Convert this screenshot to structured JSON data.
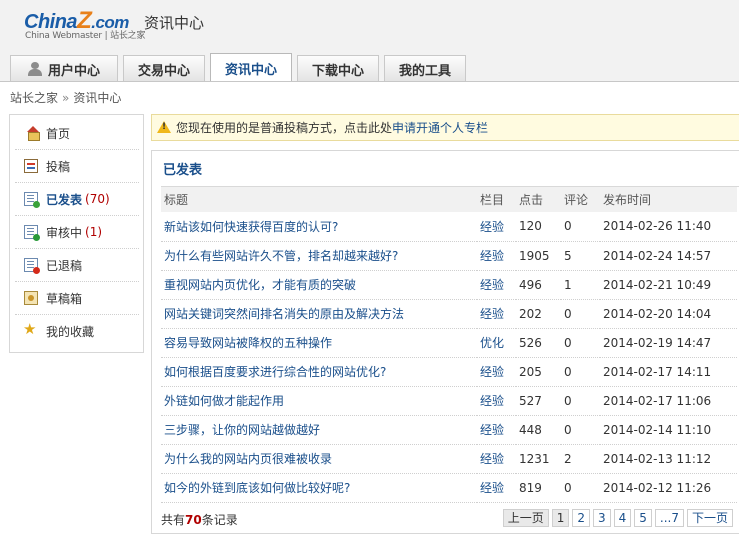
{
  "brand": {
    "logo_main_a": "China",
    "logo_main_z": "Z",
    "logo_main_c": ".com",
    "logo_sub": "China Webmaster | 站长之家",
    "site_title": "资讯中心"
  },
  "tabs": [
    {
      "label": "用户中心",
      "icon": "user-icon",
      "active": false
    },
    {
      "label": "交易中心",
      "active": false
    },
    {
      "label": "资讯中心",
      "active": true
    },
    {
      "label": "下载中心",
      "active": false
    },
    {
      "label": "我的工具",
      "active": false
    }
  ],
  "breadcrumb": {
    "home": "站长之家",
    "separator": "»",
    "current": "资讯中心"
  },
  "sidebar": {
    "items": [
      {
        "label": "首页",
        "icon": "home-icon"
      },
      {
        "label": "投稿",
        "icon": "submit-icon"
      },
      {
        "label": "已发表",
        "count": "(70)",
        "icon": "published-doc-icon",
        "active": true
      },
      {
        "label": "审核中",
        "count": "(1)",
        "icon": "pending-doc-icon"
      },
      {
        "label": "已退稿",
        "icon": "rejected-doc-icon"
      },
      {
        "label": "草稿箱",
        "icon": "drafts-icon"
      },
      {
        "label": "我的收藏",
        "icon": "favorites-star-icon"
      }
    ]
  },
  "notice": {
    "icon": "warning-icon",
    "text": "您现在使用的是普通投稿方式，点击此处",
    "link": "申请开通个人专栏"
  },
  "panel": {
    "title": "已发表",
    "columns": [
      "标题",
      "栏目",
      "点击",
      "评论",
      "发布时间"
    ],
    "rows": [
      {
        "title": "新站该如何快速获得百度的认可?",
        "category": "经验",
        "clicks": "120",
        "comments": "0",
        "time": "2014-02-26 11:40"
      },
      {
        "title": "为什么有些网站许久不管，排名却越来越好?",
        "category": "经验",
        "clicks": "1905",
        "comments": "5",
        "time": "2014-02-24 14:57"
      },
      {
        "title": "重视网站内页优化，才能有质的突破",
        "category": "经验",
        "clicks": "496",
        "comments": "1",
        "time": "2014-02-21 10:49"
      },
      {
        "title": "网站关键词突然间排名消失的原由及解决方法",
        "category": "经验",
        "clicks": "202",
        "comments": "0",
        "time": "2014-02-20 14:04"
      },
      {
        "title": "容易导致网站被降权的五种操作",
        "category": "优化",
        "clicks": "526",
        "comments": "0",
        "time": "2014-02-19 14:47"
      },
      {
        "title": "如何根据百度要求进行综合性的网站优化?",
        "category": "经验",
        "clicks": "205",
        "comments": "0",
        "time": "2014-02-17 14:11"
      },
      {
        "title": "外链如何做才能起作用",
        "category": "经验",
        "clicks": "527",
        "comments": "0",
        "time": "2014-02-17 11:06"
      },
      {
        "title": "三步骤，让你的网站越做越好",
        "category": "经验",
        "clicks": "448",
        "comments": "0",
        "time": "2014-02-14 11:10"
      },
      {
        "title": "为什么我的网站内页很难被收录",
        "category": "经验",
        "clicks": "1231",
        "comments": "2",
        "time": "2014-02-13 11:12"
      },
      {
        "title": "如今的外链到底该如何做比较好呢?",
        "category": "经验",
        "clicks": "819",
        "comments": "0",
        "time": "2014-02-12 11:26"
      }
    ],
    "footer": {
      "prefix": "共有",
      "total": "70",
      "suffix": "条记录"
    },
    "pager": {
      "prev": "上一页",
      "pages": [
        "1",
        "2",
        "3",
        "4",
        "5",
        "...7"
      ],
      "current": "1",
      "next": "下一页"
    }
  }
}
